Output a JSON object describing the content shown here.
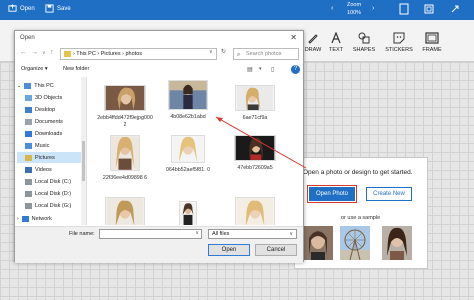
{
  "editor": {
    "open_label": "Open",
    "save_label": "Save",
    "zoom_label": "Zoom",
    "zoom_value": "100%",
    "tools": [
      {
        "label": "DRAW",
        "icon": "draw-icon"
      },
      {
        "label": "TEXT",
        "icon": "text-icon"
      },
      {
        "label": "SHAPES",
        "icon": "shapes-icon"
      },
      {
        "label": "STICKERS",
        "icon": "stickers-icon"
      },
      {
        "label": "FRAME",
        "icon": "frame-icon"
      }
    ]
  },
  "start_panel": {
    "title": "Open a photo or design to get started.",
    "open_photo": "Open Photo",
    "create_new": "Create New",
    "sample_text": "or use a sample"
  },
  "dialog": {
    "title": "Open",
    "path": [
      "This PC",
      "Pictures",
      "photos"
    ],
    "search_placeholder": "Search photos",
    "organize": "Organize ▾",
    "new_folder": "New folder",
    "nav": [
      {
        "label": "This PC",
        "icon": "computer-icon"
      },
      {
        "label": "3D Objects",
        "icon": "cube-icon"
      },
      {
        "label": "Desktop",
        "icon": "desktop-icon"
      },
      {
        "label": "Documents",
        "icon": "documents-icon"
      },
      {
        "label": "Downloads",
        "icon": "download-icon"
      },
      {
        "label": "Music",
        "icon": "music-icon"
      },
      {
        "label": "Pictures",
        "icon": "pictures-icon"
      },
      {
        "label": "Videos",
        "icon": "videos-icon"
      },
      {
        "label": "Local Disk (C:)",
        "icon": "disk-icon"
      },
      {
        "label": "Local Disk (D:)",
        "icon": "disk-icon"
      },
      {
        "label": "Local Disk (G:)",
        "icon": "disk-icon"
      },
      {
        "label": "Network",
        "icon": "network-icon"
      }
    ],
    "files": [
      {
        "name": "2ebb4ffdd472f9ejpg0002"
      },
      {
        "name": "4b08e62b1abd"
      },
      {
        "name": "6ae71cf9a"
      },
      {
        "name": "22f36ee4d09898 6"
      },
      {
        "name": "064bb52aef5f81. 0"
      },
      {
        "name": "47ebb72609a5"
      },
      {
        "name": ""
      },
      {
        "name": ""
      },
      {
        "name": ""
      }
    ],
    "file_name_label": "File name:",
    "file_name_value": "",
    "filter": "All files",
    "open_button": "Open",
    "cancel_button": "Cancel"
  }
}
